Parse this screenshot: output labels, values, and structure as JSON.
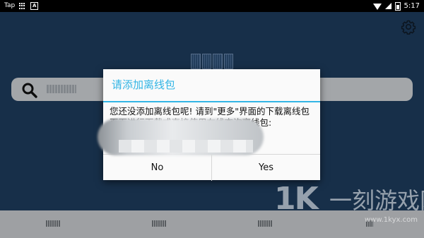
{
  "status_bar": {
    "app_label": "Tap",
    "time": "5:17"
  },
  "dialog": {
    "title": "请添加离线包",
    "message": "您还没添加离线包呢! 请到\"更多\"界面的下载离线包页面进行下载或直接使用在线查询离线包:",
    "no_label": "No",
    "yes_label": "Yes"
  },
  "watermark": {
    "logo": "1K",
    "brand": "一刻游戏网",
    "url": "www.1kyx.com"
  },
  "colors": {
    "background": "#1d3a5a",
    "accent": "#33b5e5"
  },
  "icons": [
    "grid-icon",
    "a-icon",
    "wifi-icon",
    "signal-icon",
    "battery-icon",
    "gear-icon",
    "search-icon"
  ]
}
